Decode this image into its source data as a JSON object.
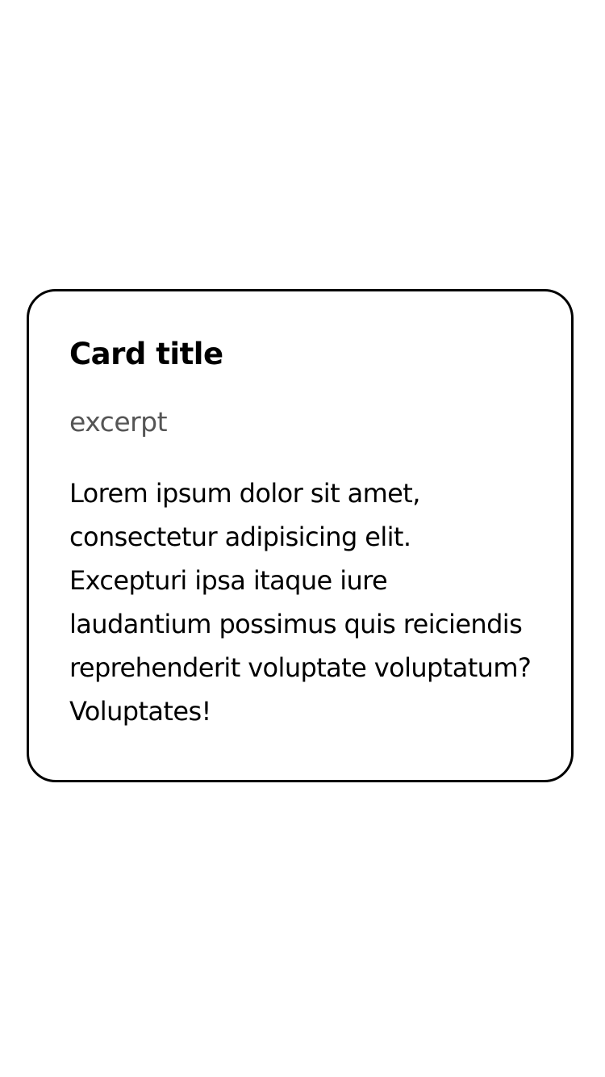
{
  "card": {
    "title": "Card title",
    "excerpt": "excerpt",
    "body_lines": [
      "Lorem ipsum dolor sit amet,",
      "consectetur adipisicing elit.",
      "Excepturi ipsa itaque iure",
      "laudantium possimus quis reiciendis",
      "reprehenderit voluptate voluptatum?",
      "Voluptates!"
    ]
  },
  "colors": {
    "background": "#ffffff",
    "text": "#000000",
    "excerpt_text": "#555555",
    "card_border": "#000000"
  }
}
